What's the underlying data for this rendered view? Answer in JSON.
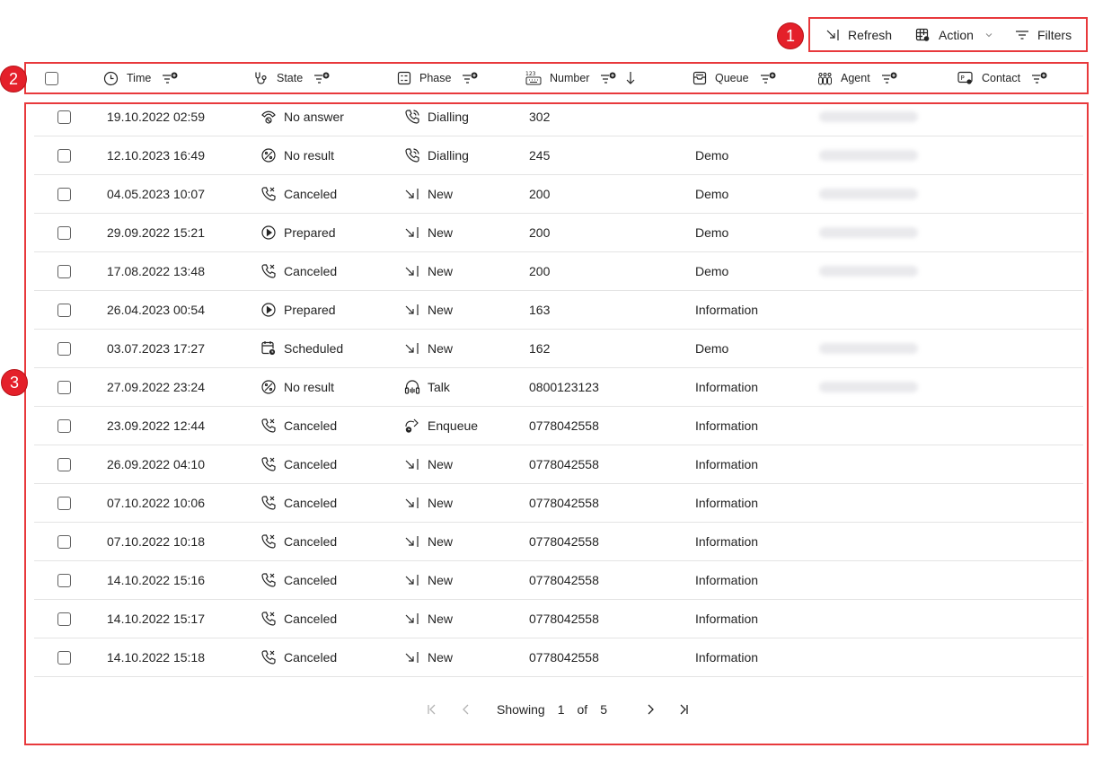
{
  "toolbar": {
    "refresh_label": "Refresh",
    "action_label": "Action",
    "filters_label": "Filters"
  },
  "columns": {
    "time": "Time",
    "state": "State",
    "phase": "Phase",
    "number": "Number",
    "queue": "Queue",
    "agent": "Agent",
    "contact": "Contact"
  },
  "markers": [
    "1",
    "2",
    "3"
  ],
  "rows": [
    {
      "time": "19.10.2022 02:59",
      "state": "No answer",
      "state_icon": "no-answer-icon",
      "phase": "Dialling",
      "phase_icon": "dialling-icon",
      "number": "302",
      "queue": "",
      "agent_blurred": true
    },
    {
      "time": "12.10.2023 16:49",
      "state": "No result",
      "state_icon": "no-result-icon",
      "phase": "Dialling",
      "phase_icon": "dialling-icon",
      "number": "245",
      "queue": "Demo",
      "agent_blurred": true
    },
    {
      "time": "04.05.2023 10:07",
      "state": "Canceled",
      "state_icon": "canceled-icon",
      "phase": "New",
      "phase_icon": "new-icon",
      "number": "200",
      "queue": "Demo",
      "agent_blurred": true
    },
    {
      "time": "29.09.2022 15:21",
      "state": "Prepared",
      "state_icon": "prepared-icon",
      "phase": "New",
      "phase_icon": "new-icon",
      "number": "200",
      "queue": "Demo",
      "agent_blurred": true
    },
    {
      "time": "17.08.2022 13:48",
      "state": "Canceled",
      "state_icon": "canceled-icon",
      "phase": "New",
      "phase_icon": "new-icon",
      "number": "200",
      "queue": "Demo",
      "agent_blurred": true
    },
    {
      "time": "26.04.2023 00:54",
      "state": "Prepared",
      "state_icon": "prepared-icon",
      "phase": "New",
      "phase_icon": "new-icon",
      "number": "163",
      "queue": "Information",
      "agent_blurred": false
    },
    {
      "time": "03.07.2023 17:27",
      "state": "Scheduled",
      "state_icon": "scheduled-icon",
      "phase": "New",
      "phase_icon": "new-icon",
      "number": "162",
      "queue": "Demo",
      "agent_blurred": true
    },
    {
      "time": "27.09.2022 23:24",
      "state": "No result",
      "state_icon": "no-result-icon",
      "phase": "Talk",
      "phase_icon": "talk-icon",
      "number": "0800123123",
      "queue": "Information",
      "agent_blurred": true
    },
    {
      "time": "23.09.2022 12:44",
      "state": "Canceled",
      "state_icon": "canceled-icon",
      "phase": "Enqueue",
      "phase_icon": "enqueue-icon",
      "number": "0778042558",
      "queue": "Information",
      "agent_blurred": false
    },
    {
      "time": "26.09.2022 04:10",
      "state": "Canceled",
      "state_icon": "canceled-icon",
      "phase": "New",
      "phase_icon": "new-icon",
      "number": "0778042558",
      "queue": "Information",
      "agent_blurred": false
    },
    {
      "time": "07.10.2022 10:06",
      "state": "Canceled",
      "state_icon": "canceled-icon",
      "phase": "New",
      "phase_icon": "new-icon",
      "number": "0778042558",
      "queue": "Information",
      "agent_blurred": false
    },
    {
      "time": "07.10.2022 10:18",
      "state": "Canceled",
      "state_icon": "canceled-icon",
      "phase": "New",
      "phase_icon": "new-icon",
      "number": "0778042558",
      "queue": "Information",
      "agent_blurred": false
    },
    {
      "time": "14.10.2022 15:16",
      "state": "Canceled",
      "state_icon": "canceled-icon",
      "phase": "New",
      "phase_icon": "new-icon",
      "number": "0778042558",
      "queue": "Information",
      "agent_blurred": false
    },
    {
      "time": "14.10.2022 15:17",
      "state": "Canceled",
      "state_icon": "canceled-icon",
      "phase": "New",
      "phase_icon": "new-icon",
      "number": "0778042558",
      "queue": "Information",
      "agent_blurred": false
    },
    {
      "time": "14.10.2022 15:18",
      "state": "Canceled",
      "state_icon": "canceled-icon",
      "phase": "New",
      "phase_icon": "new-icon",
      "number": "0778042558",
      "queue": "Information",
      "agent_blurred": false
    }
  ],
  "pagination": {
    "showing_label": "Showing",
    "current_page": "1",
    "of_label": "of",
    "total_pages": "5"
  },
  "colors": {
    "callout": "#e8393c",
    "text": "#242424",
    "divider": "#e4e4e4",
    "muted_icon": "#b3b3b3"
  }
}
